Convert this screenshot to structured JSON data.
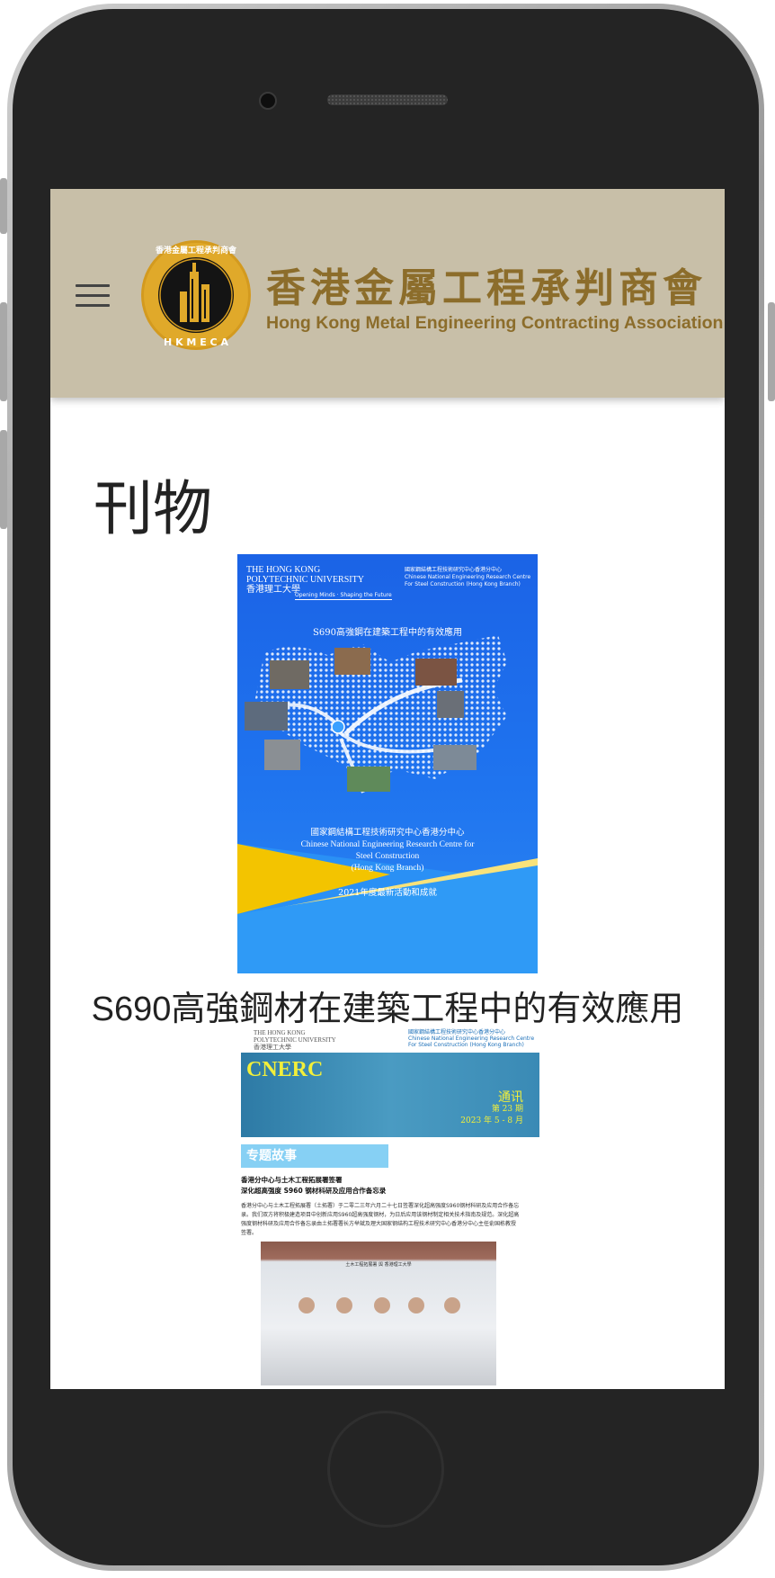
{
  "header": {
    "brand_zh": "香港金屬工程承判商會",
    "brand_en": "Hong Kong Metal Engineering Contracting Association",
    "logo_letters": "H K M E C A",
    "logo_ring_text": "香港金屬工程承判商會"
  },
  "page": {
    "title": "刊物"
  },
  "publications": [
    {
      "caption": "S690高強鋼材在建築工程中的有效應用",
      "cover": {
        "org_left_1": "THE HONG KONG",
        "org_left_2": "POLYTECHNIC UNIVERSITY",
        "org_left_3": "香港理工大學",
        "org_right_1": "國家鋼結構工程技術研究中心香港分中心",
        "org_right_2": "Chinese National Engineering Research Centre",
        "org_right_3": "For Steel Construction (Hong Kong Branch)",
        "tagline": "Opening Minds · Shaping the Future",
        "title": "S690高強鋼在建築工程中的有效應用",
        "foot_1": "國家鋼結構工程技術研究中心香港分中心",
        "foot_2": "Chinese National Engineering Research Centre for",
        "foot_3": "Steel Construction",
        "foot_4": "(Hong Kong Branch)",
        "year": "2021年度最新活動和成就"
      }
    },
    {
      "cover": {
        "hdr_left_1": "THE HONG KONG",
        "hdr_left_2": "POLYTECHNIC UNIVERSITY",
        "hdr_left_3": "香港理工大學",
        "hdr_right_1": "國家鋼結構工程技術研究中心香港分中心",
        "hdr_right_2": "Chinese National Engineering Research Centre",
        "hdr_right_3": "For Steel Construction (Hong Kong Branch)",
        "cnerc": "CNERC",
        "newsletter": "通讯",
        "issue": "第 23 期",
        "date": "2023 年 5 - 8 月",
        "feature": "专题故事",
        "story_head_1": "香港分中心与土木工程拓展署签署",
        "story_head_2": "深化超高强度 S960 钢材科研及应用合作备忘录",
        "story_body": "香港分中心与土木工程拓展署（土拓署）于二零二三年六月二十七日签署深化超高强度S960钢材科研及应用合作备忘录。我们双方将积极建造项目中创新应用S960超高强度钢材，为日后应用该钢材制定相关技术指南及规范。深化超高强度钢材科研及应用合作备忘录由土拓署署长方举斌及理大国家钢结构工程技术研究中心香港分中心主任俞国栋教授签署。",
        "photo_title": "土木工程拓展署 與 香港理工大學"
      }
    }
  ],
  "colors": {
    "header_bg": "#c8bfa8",
    "brand_gold": "#8c6d2b",
    "cover_blue": "#1f74ef"
  }
}
